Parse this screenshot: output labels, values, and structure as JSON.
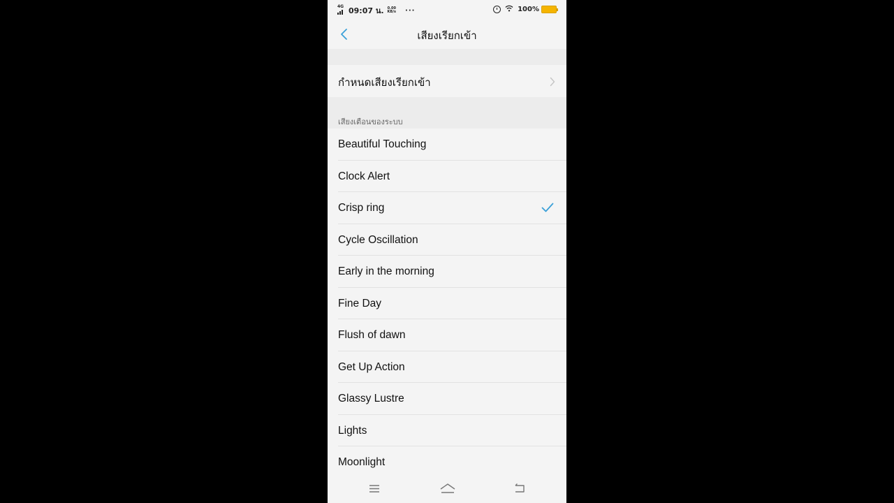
{
  "status_bar": {
    "network": "4G",
    "time": "09:07 น.",
    "speed_value": "0.00",
    "speed_unit": "KB/s",
    "more": "···",
    "battery": "100%"
  },
  "header": {
    "title": "เสียงเรียกเข้า"
  },
  "set_ringtone": {
    "label": "กำหนดเสียงเรียกเข้า"
  },
  "section": {
    "label": "เสียงเตือนของระบบ"
  },
  "ringtones": [
    {
      "label": "Beautiful Touching",
      "selected": false
    },
    {
      "label": "Clock Alert",
      "selected": false
    },
    {
      "label": "Crisp ring",
      "selected": true
    },
    {
      "label": "Cycle Oscillation",
      "selected": false
    },
    {
      "label": "Early in the morning",
      "selected": false
    },
    {
      "label": "Fine Day",
      "selected": false
    },
    {
      "label": "Flush of dawn",
      "selected": false
    },
    {
      "label": "Get Up Action",
      "selected": false
    },
    {
      "label": "Glassy Lustre",
      "selected": false
    },
    {
      "label": "Lights",
      "selected": false
    },
    {
      "label": "Moonlight",
      "selected": false
    }
  ],
  "colors": {
    "accent": "#3aa0d8",
    "background": "#f4f4f4",
    "battery": "#f5b400"
  }
}
